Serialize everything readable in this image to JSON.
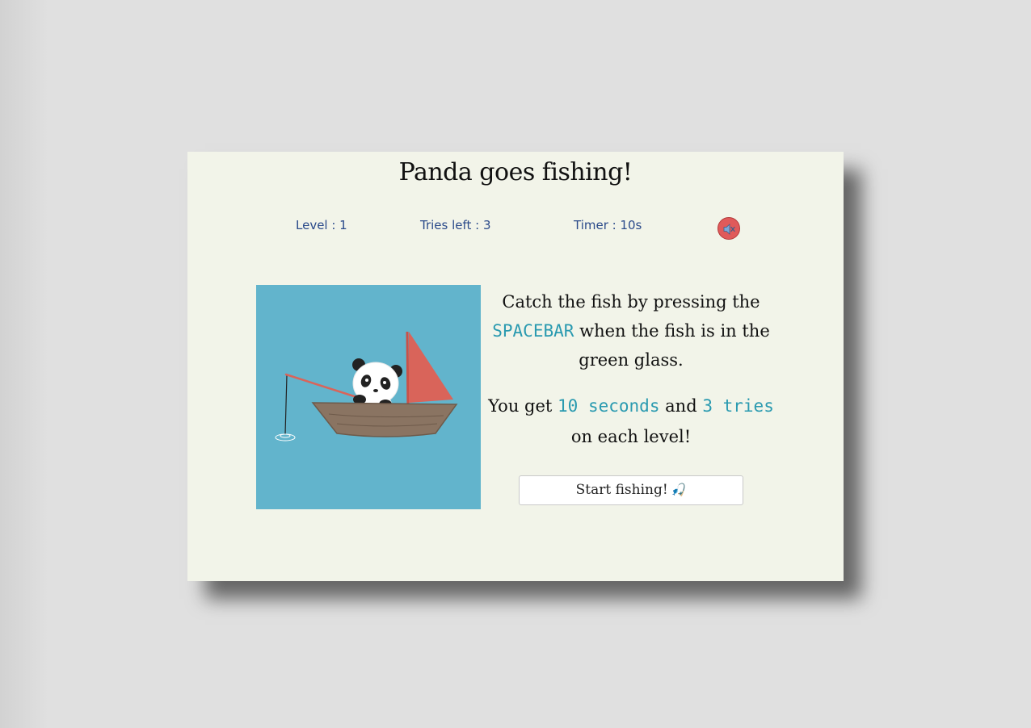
{
  "game": {
    "title": "Panda goes fishing!"
  },
  "status": {
    "level": "Level : 1",
    "tries": "Tries left : 3",
    "timer": "Timer : 10s",
    "sound_icon": "speaker-muted-icon"
  },
  "instructions": {
    "line1_before": "Catch the fish by pressing the",
    "key": "SPACEBAR",
    "line1_after": "when the fish is in the green glass.",
    "line2_before": "You get",
    "seconds": "10 seconds",
    "line2_mid": "and",
    "tries": "3 tries",
    "line2_after": "on each level!"
  },
  "start_button": {
    "label": "Start fishing!",
    "icon": "🎣"
  },
  "colors": {
    "card_background": "#f2f4e9",
    "scene_water": "#62b4cc",
    "highlight": "#2a9ab0",
    "status_text": "#2a4a8a",
    "sound_button": "#e05a5a",
    "sail": "#d9645a",
    "boat": "#8a7462"
  }
}
